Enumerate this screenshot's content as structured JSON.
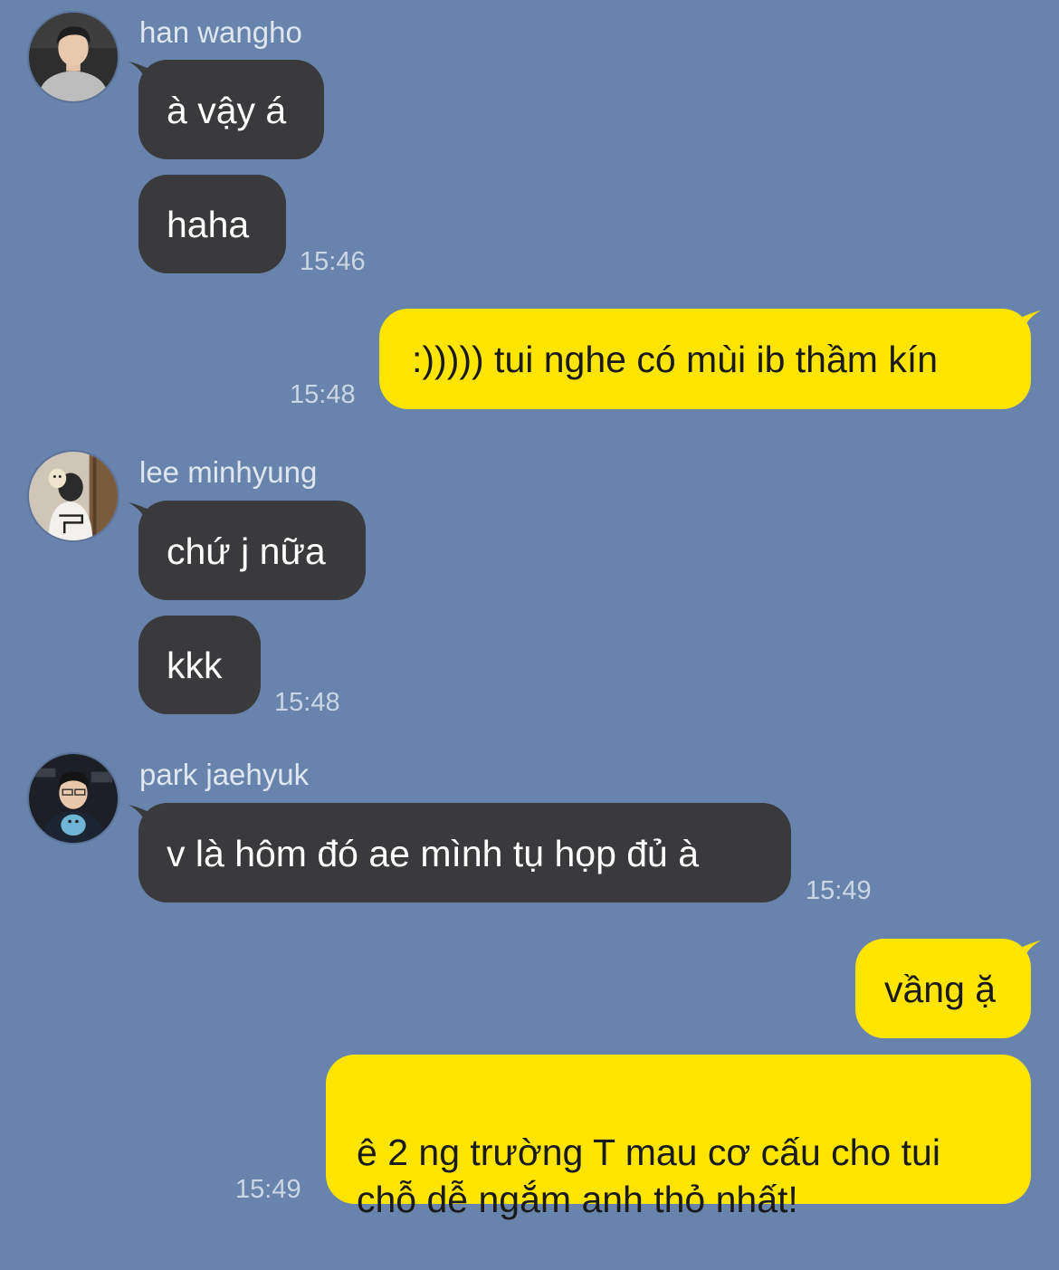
{
  "chat": {
    "background_color": "#6984ac",
    "incoming_bubble_color": "#3a3a3c",
    "outgoing_bubble_color": "#fee500",
    "groups": [
      {
        "sender": "han wangho",
        "avatar_icon": "avatar-han-wangho-icon",
        "messages": [
          "à vậy á",
          "haha"
        ],
        "time": "15:46"
      },
      {
        "outgoing": true,
        "messages": [
          ":))))) tui nghe có mùi ib thầm kín"
        ],
        "time": "15:48"
      },
      {
        "sender": "lee minhyung",
        "avatar_icon": "avatar-lee-minhyung-icon",
        "messages": [
          "chứ j nữa",
          "kkk"
        ],
        "time": "15:48"
      },
      {
        "sender": "park jaehyuk",
        "avatar_icon": "avatar-park-jaehyuk-icon",
        "messages": [
          "v là hôm đó ae mình tụ họp đủ à"
        ],
        "time": "15:49"
      },
      {
        "outgoing": true,
        "messages": [
          "vầng ặ",
          "ê 2 ng trường T mau cơ cấu cho tui\nchỗ dễ ngắm anh thỏ nhất!"
        ],
        "time": "15:49"
      }
    ]
  }
}
